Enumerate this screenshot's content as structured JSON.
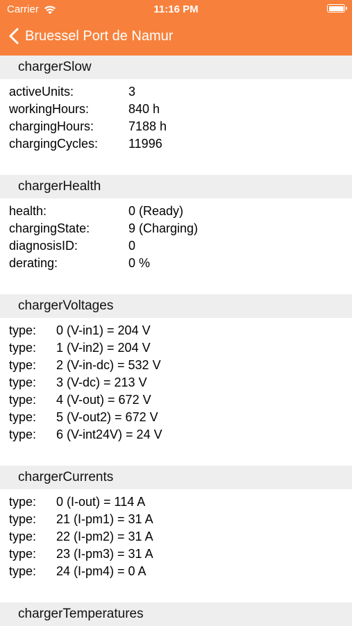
{
  "status_bar": {
    "carrier": "Carrier",
    "time": "11:16 PM",
    "wifi_icon": "wifi-icon",
    "battery_icon": "battery-icon"
  },
  "nav": {
    "back_icon": "chevron-left-icon",
    "title": "Bruessel Port de Namur"
  },
  "colors": {
    "accent": "#f7813c",
    "section_bg": "#eeeeee"
  },
  "sections": {
    "charger_slow": {
      "title": "chargerSlow",
      "rows": [
        {
          "key": "activeUnits:",
          "value": "3"
        },
        {
          "key": "workingHours:",
          "value": "840 h"
        },
        {
          "key": "chargingHours:",
          "value": "7188 h"
        },
        {
          "key": "chargingCycles:",
          "value": "11996"
        }
      ]
    },
    "charger_health": {
      "title": "chargerHealth",
      "rows": [
        {
          "key": "health:",
          "value": "0 (Ready)"
        },
        {
          "key": "chargingState:",
          "value": "9 (Charging)"
        },
        {
          "key": "diagnosisID:",
          "value": "0"
        },
        {
          "key": "derating:",
          "value": "0 %"
        }
      ]
    },
    "charger_voltages": {
      "title": "chargerVoltages",
      "rows": [
        {
          "key": "type:",
          "value": "0 (V-in1) = 204 V"
        },
        {
          "key": "type:",
          "value": "1 (V-in2) = 204 V"
        },
        {
          "key": "type:",
          "value": "2 (V-in-dc) = 532 V"
        },
        {
          "key": "type:",
          "value": "3 (V-dc) = 213 V"
        },
        {
          "key": "type:",
          "value": "4 (V-out) = 672 V"
        },
        {
          "key": "type:",
          "value": "5 (V-out2) = 672 V"
        },
        {
          "key": "type:",
          "value": "6 (V-int24V) = 24 V"
        }
      ]
    },
    "charger_currents": {
      "title": "chargerCurrents",
      "rows": [
        {
          "key": "type:",
          "value": "0 (I-out) = 114 A"
        },
        {
          "key": "type:",
          "value": "21 (I-pm1) = 31 A"
        },
        {
          "key": "type:",
          "value": "22 (I-pm2) = 31 A"
        },
        {
          "key": "type:",
          "value": "23 (I-pm3) = 31 A"
        },
        {
          "key": "type:",
          "value": "24 (I-pm4) = 0 A"
        }
      ]
    },
    "charger_temperatures": {
      "title": "chargerTemperatures"
    }
  }
}
